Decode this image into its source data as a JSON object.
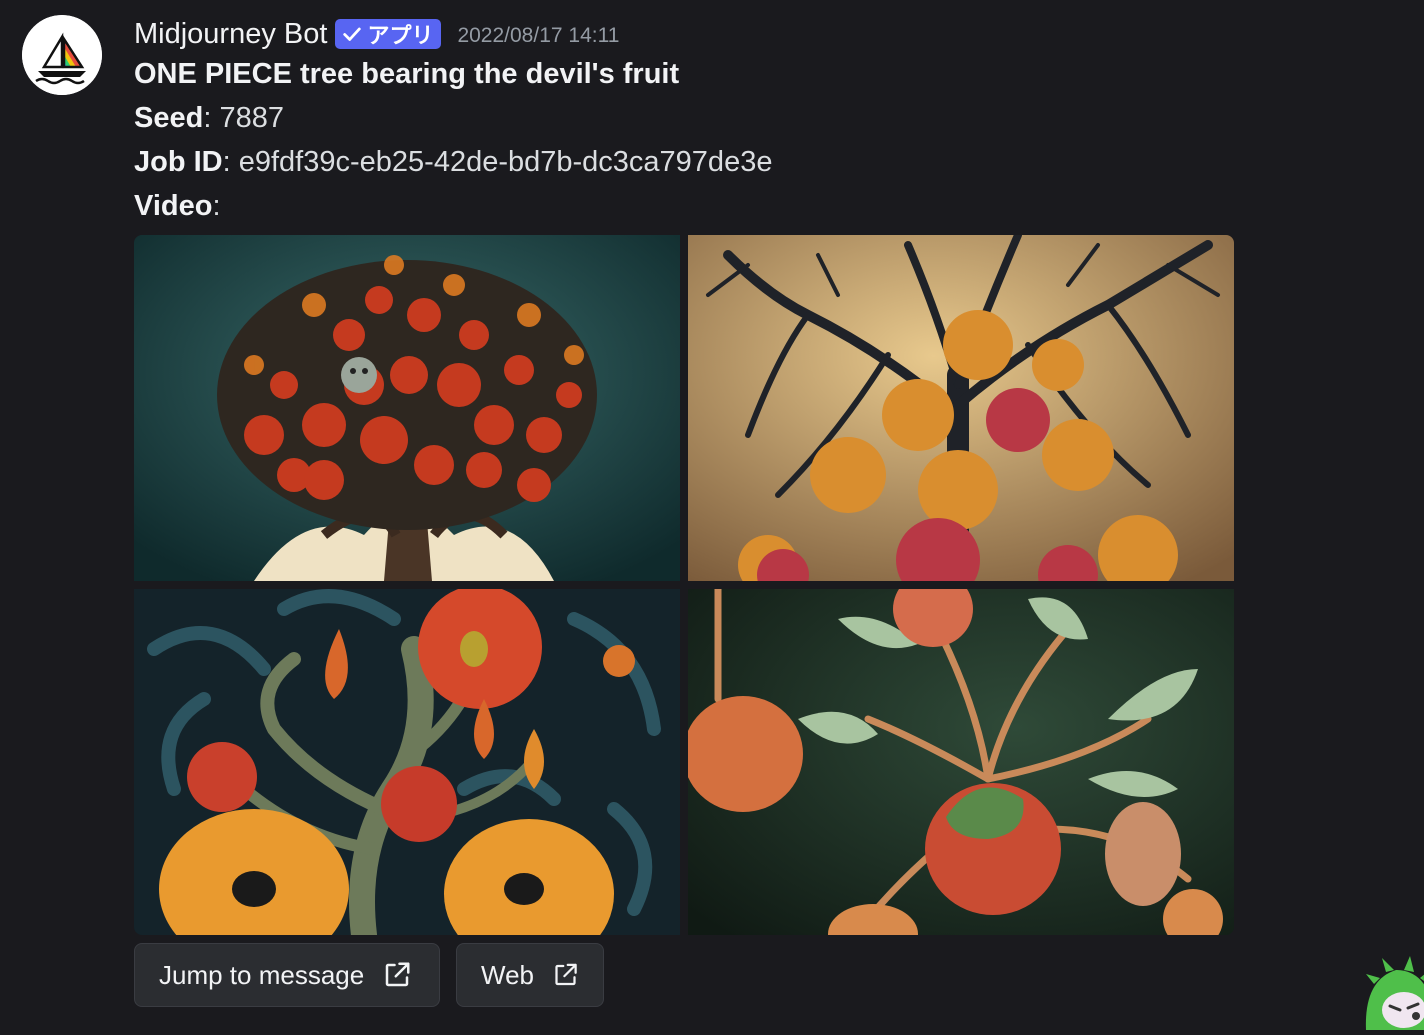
{
  "author": {
    "username": "Midjourney Bot",
    "badge": "アプリ",
    "timestamp": "2022/08/17 14:11"
  },
  "content": {
    "prompt": "ONE PIECE tree bearing the devil's fruit",
    "seed_label": "Seed",
    "seed_value": ": 7887",
    "jobid_label": "Job ID",
    "jobid_value": ": e9fdf39c-eb25-42de-bd7b-dc3ca797de3e",
    "video_label": "Video",
    "video_value": ":"
  },
  "images": [
    {
      "name": "image-1"
    },
    {
      "name": "image-2"
    },
    {
      "name": "image-3"
    },
    {
      "name": "image-4"
    }
  ],
  "buttons": {
    "jump_label": "Jump to message",
    "web_label": "Web"
  },
  "colors": {
    "background": "#1a1a1e",
    "badge": "#5865f2",
    "button_bg": "#2b2d31"
  }
}
